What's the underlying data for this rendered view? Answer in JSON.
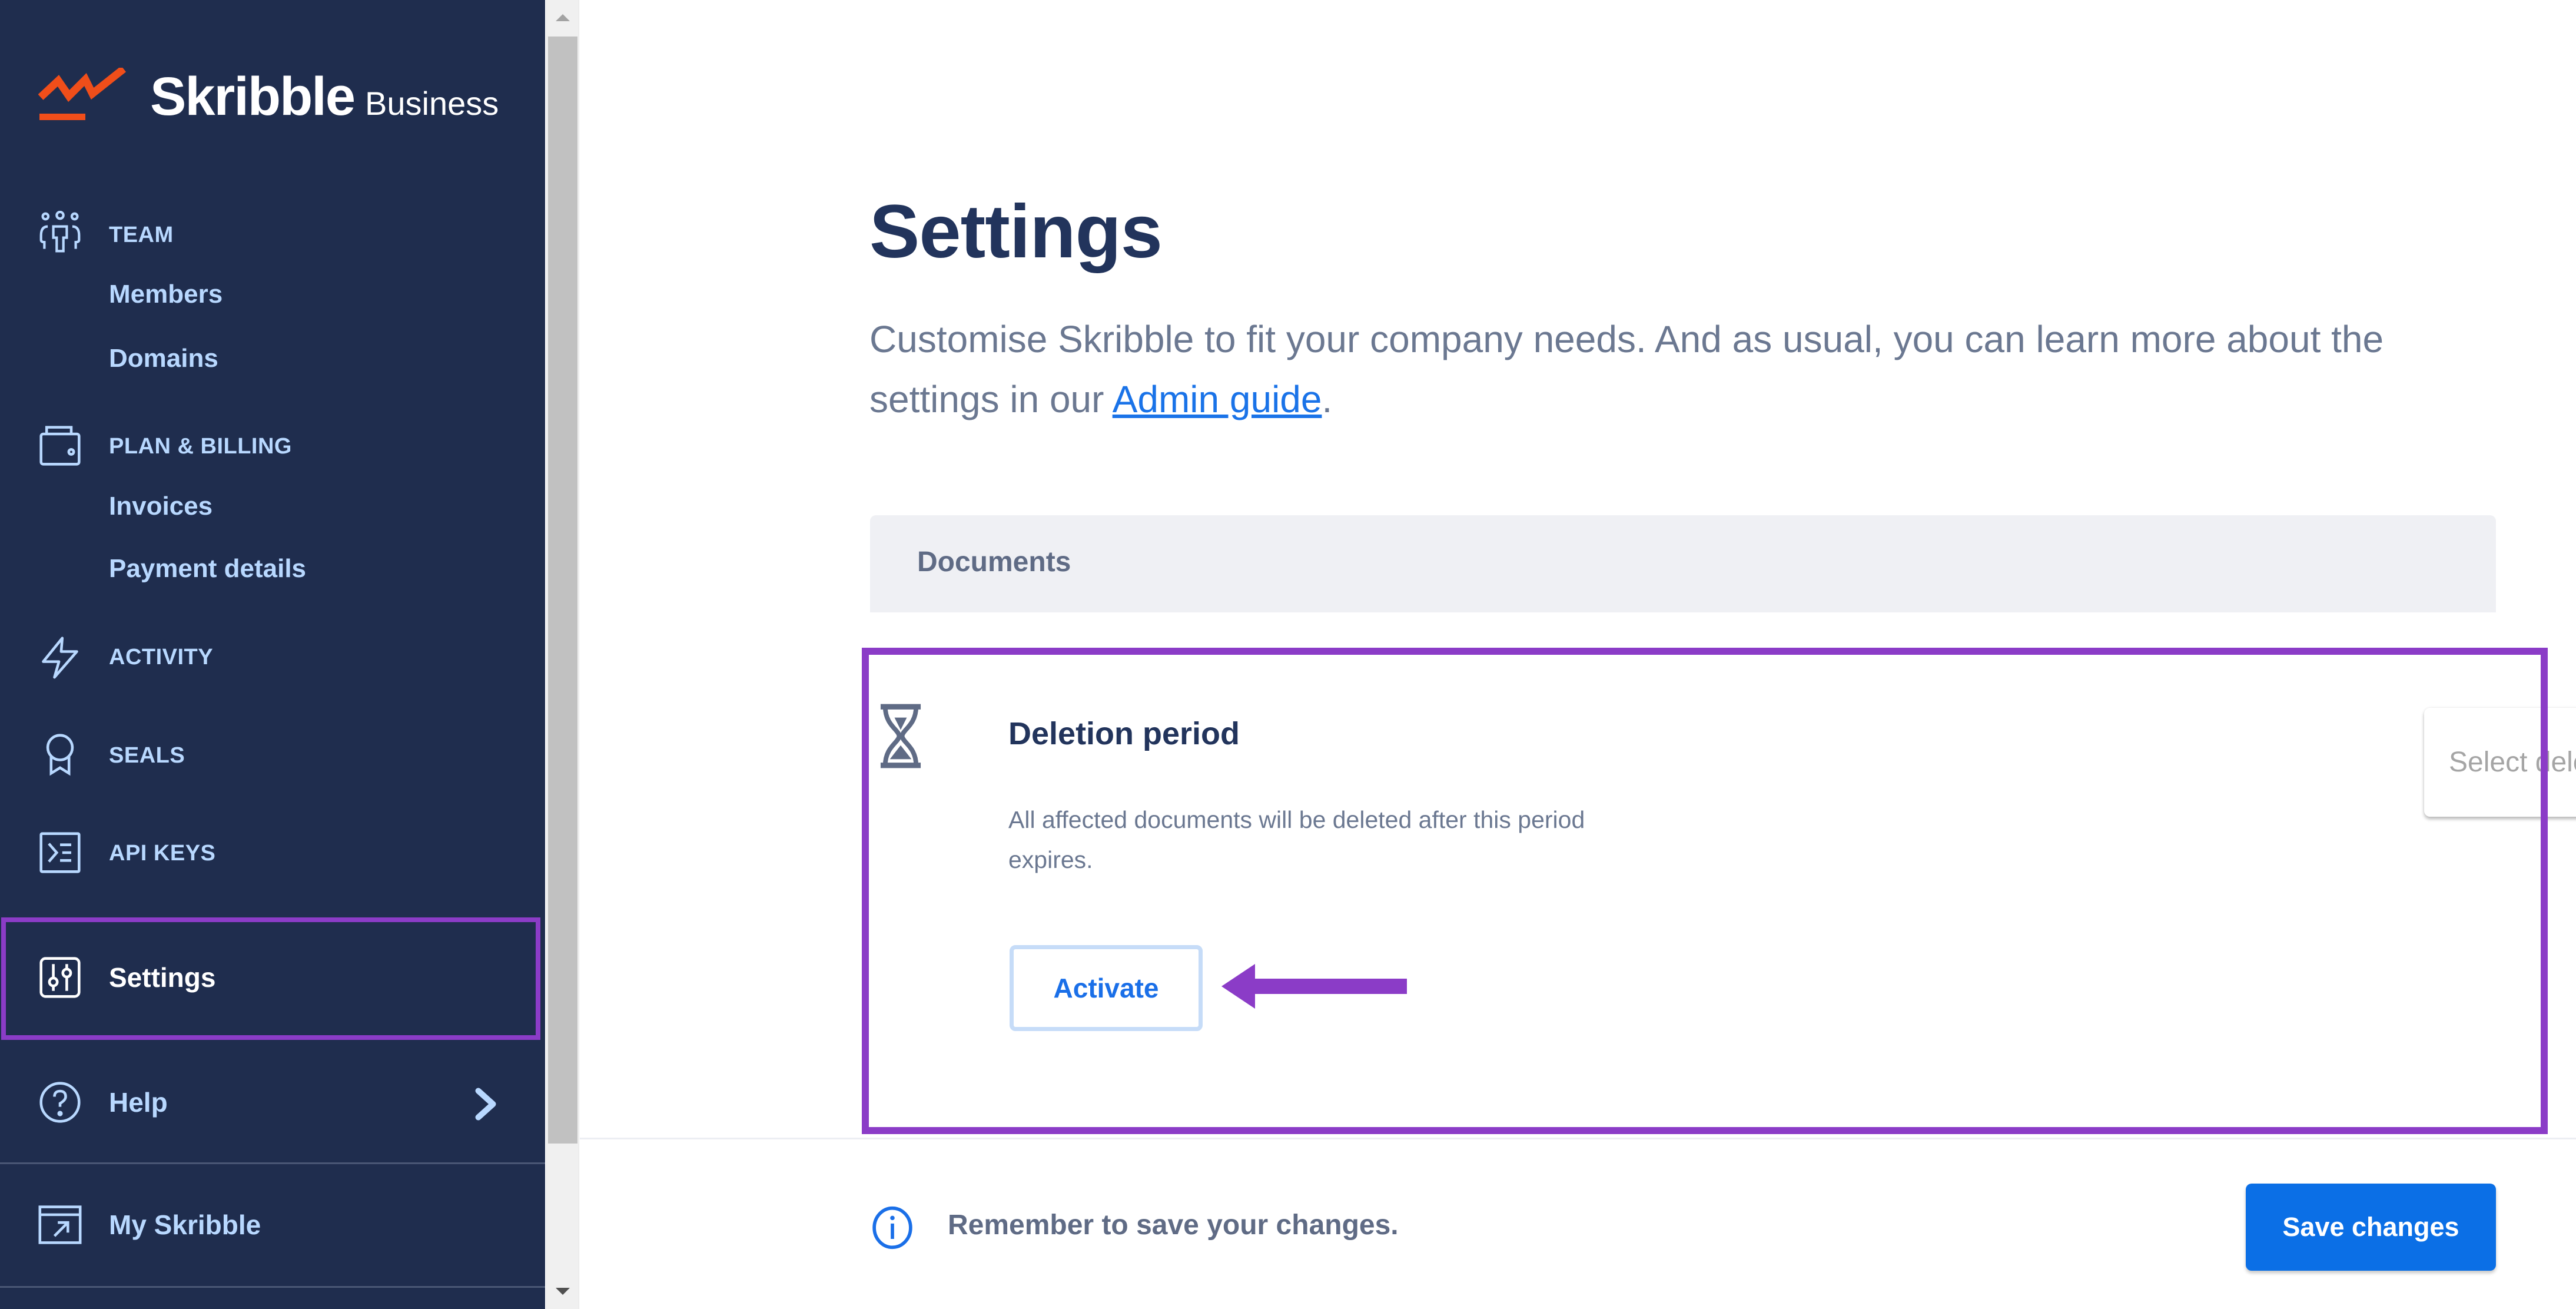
{
  "brand": {
    "name": "Skribble",
    "product": "Business",
    "logo_color": "#f04e1a"
  },
  "sidebar": {
    "sections": [
      {
        "id": "team",
        "icon": "team-icon",
        "label": "TEAM",
        "children": [
          "Members",
          "Domains"
        ]
      },
      {
        "id": "plan-billing",
        "icon": "wallet-icon",
        "label": "PLAN & BILLING",
        "children": [
          "Invoices",
          "Payment details"
        ]
      },
      {
        "id": "activity",
        "icon": "lightning-icon",
        "label": "ACTIVITY"
      },
      {
        "id": "seals",
        "icon": "seal-badge-icon",
        "label": "SEALS"
      },
      {
        "id": "api-keys",
        "icon": "terminal-icon",
        "label": "API KEYS"
      }
    ],
    "settings_label": "Settings",
    "help_label": "Help",
    "my_skribble_label": "My Skribble",
    "active_item": "Settings"
  },
  "main": {
    "title": "Settings",
    "description_prefix": "Customise Skribble to fit your company needs. And as usual, you can learn more about the settings in our ",
    "description_link": "Admin guide",
    "description_suffix": ".",
    "section": {
      "header": "Documents",
      "setting": {
        "icon": "hourglass-icon",
        "title": "Deletion period",
        "description": "All affected documents will be deleted after this period expires.",
        "select_placeholder": "Select deletion period",
        "activate_label": "Activate"
      }
    }
  },
  "footer": {
    "reminder": "Remember to save your changes.",
    "save_label": "Save changes"
  },
  "colors": {
    "sidebar_bg": "#1f2d4e",
    "sidebar_text": "#b8d8ff",
    "primary": "#0b6fe6",
    "annotation": "#8b3cc7",
    "heading": "#22345c",
    "muted": "#6b7891"
  }
}
